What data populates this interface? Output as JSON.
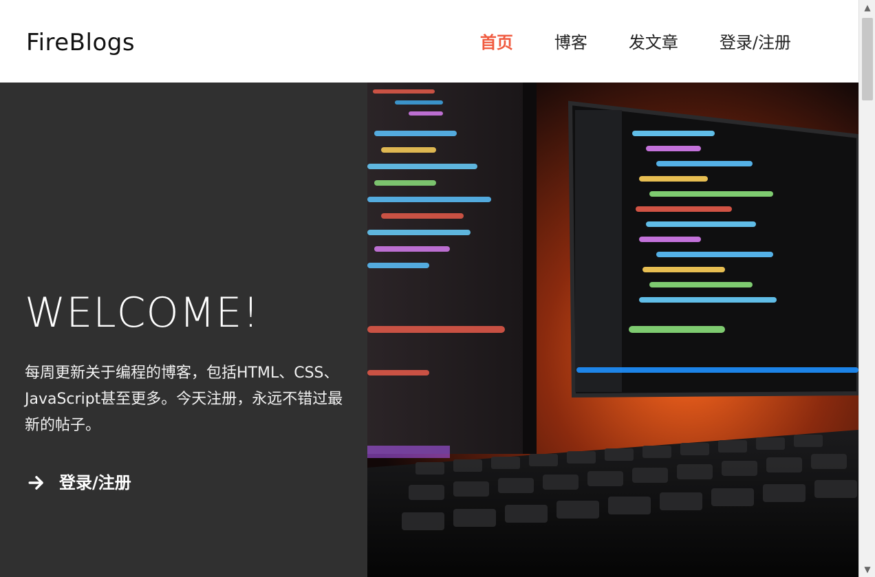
{
  "brand": {
    "logo_text": "FireBlogs"
  },
  "nav": {
    "items": [
      {
        "label": "首页",
        "active": true
      },
      {
        "label": "博客",
        "active": false
      },
      {
        "label": "发文章",
        "active": false
      },
      {
        "label": "登录/注册",
        "active": false
      }
    ]
  },
  "hero": {
    "title": "WELCOME!",
    "description": "每周更新关于编程的博客，包括HTML、CSS、JavaScript甚至更多。今天注册，永远不错过最新的帖子。",
    "cta_label": "登录/注册",
    "cta_icon": "arrow-right-icon",
    "image_subject": "monitor-and-keyboard-photo"
  },
  "colors": {
    "accent": "#f05a3f",
    "hero_left_bg": "#303030",
    "header_bg": "#ffffff"
  }
}
